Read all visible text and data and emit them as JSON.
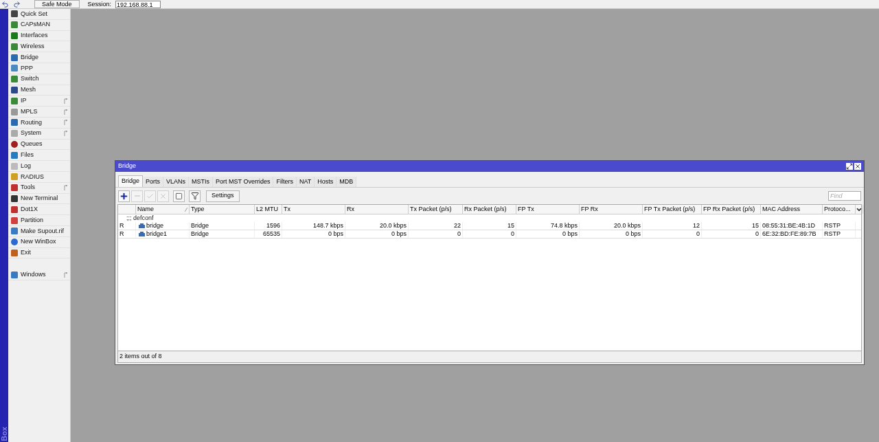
{
  "top_toolbar": {
    "safe_mode": "Safe Mode",
    "session_label": "Session:",
    "session_value": "192.168.88.1"
  },
  "brand": "Box",
  "menu": {
    "items": [
      {
        "label": "Quick Set",
        "submenu": false
      },
      {
        "label": "CAPsMAN",
        "submenu": false
      },
      {
        "label": "Interfaces",
        "submenu": false
      },
      {
        "label": "Wireless",
        "submenu": false
      },
      {
        "label": "Bridge",
        "submenu": false
      },
      {
        "label": "PPP",
        "submenu": false
      },
      {
        "label": "Switch",
        "submenu": false
      },
      {
        "label": "Mesh",
        "submenu": false
      },
      {
        "label": "IP",
        "submenu": true
      },
      {
        "label": "MPLS",
        "submenu": true
      },
      {
        "label": "Routing",
        "submenu": true
      },
      {
        "label": "System",
        "submenu": true
      },
      {
        "label": "Queues",
        "submenu": false
      },
      {
        "label": "Files",
        "submenu": false
      },
      {
        "label": "Log",
        "submenu": false
      },
      {
        "label": "RADIUS",
        "submenu": false
      },
      {
        "label": "Tools",
        "submenu": true
      },
      {
        "label": "New Terminal",
        "submenu": false
      },
      {
        "label": "Dot1X",
        "submenu": false
      },
      {
        "label": "Partition",
        "submenu": false
      },
      {
        "label": "Make Supout.rif",
        "submenu": false
      },
      {
        "label": "New WinBox",
        "submenu": false
      },
      {
        "label": "Exit",
        "submenu": false
      }
    ],
    "bottom_items": [
      {
        "label": "Windows",
        "submenu": true
      }
    ]
  },
  "window": {
    "title": "Bridge",
    "tabs": [
      {
        "label": "Bridge",
        "selected": true
      },
      {
        "label": "Ports",
        "selected": false
      },
      {
        "label": "VLANs",
        "selected": false
      },
      {
        "label": "MSTIs",
        "selected": false
      },
      {
        "label": "Port MST Overrides",
        "selected": false
      },
      {
        "label": "Filters",
        "selected": false
      },
      {
        "label": "NAT",
        "selected": false
      },
      {
        "label": "Hosts",
        "selected": false
      },
      {
        "label": "MDB",
        "selected": false
      }
    ],
    "tool_buttons": [
      {
        "kind": "add",
        "disabled": false
      },
      {
        "kind": "remove",
        "disabled": true
      },
      {
        "kind": "enable",
        "disabled": true
      },
      {
        "kind": "disable",
        "disabled": true
      },
      {
        "kind": "comment",
        "disabled": false
      },
      {
        "kind": "filter",
        "disabled": false
      }
    ],
    "settings_button": "Settings",
    "find": {
      "placeholder": "Find"
    },
    "table": {
      "columns": [
        {
          "kind": "flag",
          "sorted": false
        },
        {
          "label": "Name",
          "kind": "text",
          "sorted": true
        },
        {
          "label": "Type",
          "kind": "text",
          "sorted": false
        },
        {
          "label": "L2 MTU",
          "kind": "number",
          "sorted": false
        },
        {
          "label": "Tx",
          "kind": "number",
          "sorted": false
        },
        {
          "label": "Rx",
          "kind": "number",
          "sorted": false
        },
        {
          "label": "Tx Packet (p/s)",
          "kind": "number",
          "sorted": false
        },
        {
          "label": "Rx Packet (p/s)",
          "kind": "number",
          "sorted": false
        },
        {
          "label": "FP Tx",
          "kind": "number",
          "sorted": false
        },
        {
          "label": "FP Rx",
          "kind": "number",
          "sorted": false
        },
        {
          "label": "FP Tx Packet (p/s)",
          "kind": "number",
          "sorted": false
        },
        {
          "label": "FP Rx Packet (p/s)",
          "kind": "number",
          "sorted": false
        },
        {
          "label": "MAC Address",
          "kind": "text",
          "sorted": false
        },
        {
          "label": "Protoco...",
          "kind": "text",
          "sorted": false
        }
      ],
      "comment": ";;; defconf",
      "rows": [
        {
          "cells": [
            "R",
            "bridge",
            "Bridge",
            "1596",
            "148.7 kbps",
            "20.0 kbps",
            "22",
            "15",
            "74.8 kbps",
            "20.0 kbps",
            "12",
            "15",
            "08:55:31:BE:4B:1D",
            "RSTP"
          ]
        },
        {
          "cells": [
            "R",
            "bridge1",
            "Bridge",
            "65535",
            "0 bps",
            "0 bps",
            "0",
            "0",
            "0 bps",
            "0 bps",
            "0",
            "0",
            "6E:32:BD:FE:89:7B",
            "RSTP"
          ]
        }
      ]
    },
    "status": "2 items out of 8"
  }
}
